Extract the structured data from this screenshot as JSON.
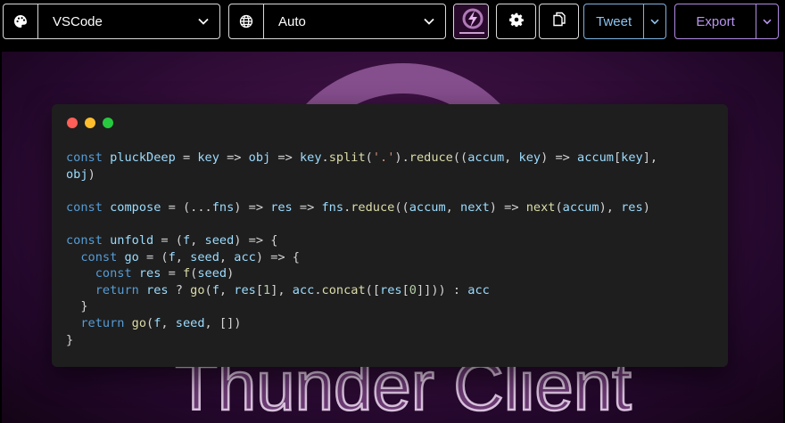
{
  "toolbar": {
    "theme_select": {
      "value": "VSCode",
      "icon": "palette-icon"
    },
    "language_select": {
      "value": "Auto",
      "icon": "globe-icon"
    },
    "background_thumbnail": {
      "icon": "thunder-logo"
    },
    "settings_icon": "gear-icon",
    "copy_icon": "copy-icon",
    "tweet": {
      "label": "Tweet",
      "color": "#8cc4f2"
    },
    "export": {
      "label": "Export",
      "color": "#b995ef"
    }
  },
  "canvas": {
    "background_colors": [
      "#4a1650",
      "#22072a"
    ],
    "background_logo_text": "Thunder Client"
  },
  "window": {
    "controls": [
      "close",
      "minimize",
      "maximize"
    ],
    "code_lines": [
      "const pluckDeep = key => obj => key.split('.').reduce((accum, key) => accum[key],",
      "obj)",
      "",
      "const compose = (...fns) => res => fns.reduce((accum, next) => next(accum), res)",
      "",
      "const unfold = (f, seed) => {",
      "  const go = (f, seed, acc) => {",
      "    const res = f(seed)",
      "    return res ? go(f, res[1], acc.concat([res[0]])) : acc",
      "  }",
      "  return go(f, seed, [])",
      "}"
    ]
  }
}
